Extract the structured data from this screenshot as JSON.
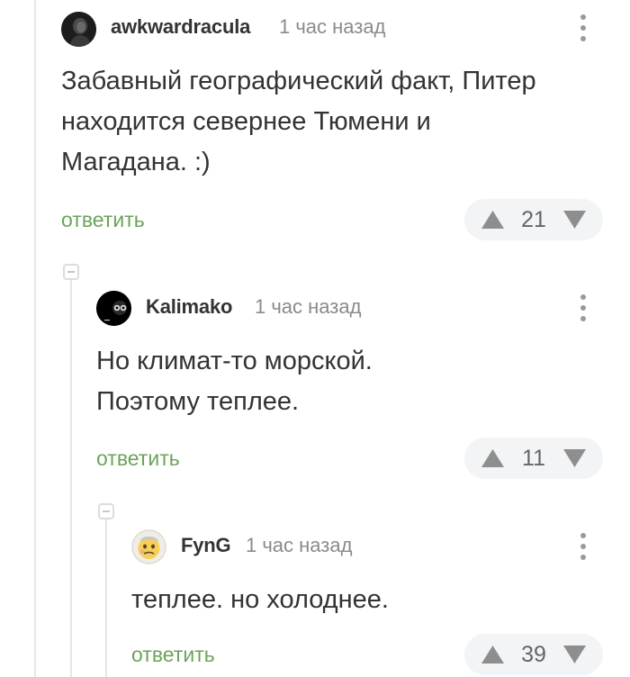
{
  "comments": [
    {
      "username": "awkwardracula",
      "time": "1 час назад",
      "text_lines": [
        "Забавный географический факт, Питер",
        "находится севернее Тюмени и",
        "Магадана. :)"
      ],
      "reply_label": "ответить",
      "rating": "21"
    },
    {
      "username": "Kalimako",
      "time": "1 час назад",
      "text_lines": [
        "Но климат-то морской.",
        "Поэтому теплее."
      ],
      "reply_label": "ответить",
      "rating": "11"
    },
    {
      "username": "FynG",
      "time": "1 час назад",
      "text_lines": [
        "теплее. но холоднее."
      ],
      "reply_label": "ответить",
      "rating": "39"
    }
  ],
  "colors": {
    "reply_green": "#6ba35a",
    "vote_bg": "#f2f4f6",
    "vote_arrow": "#8e8e8e"
  }
}
